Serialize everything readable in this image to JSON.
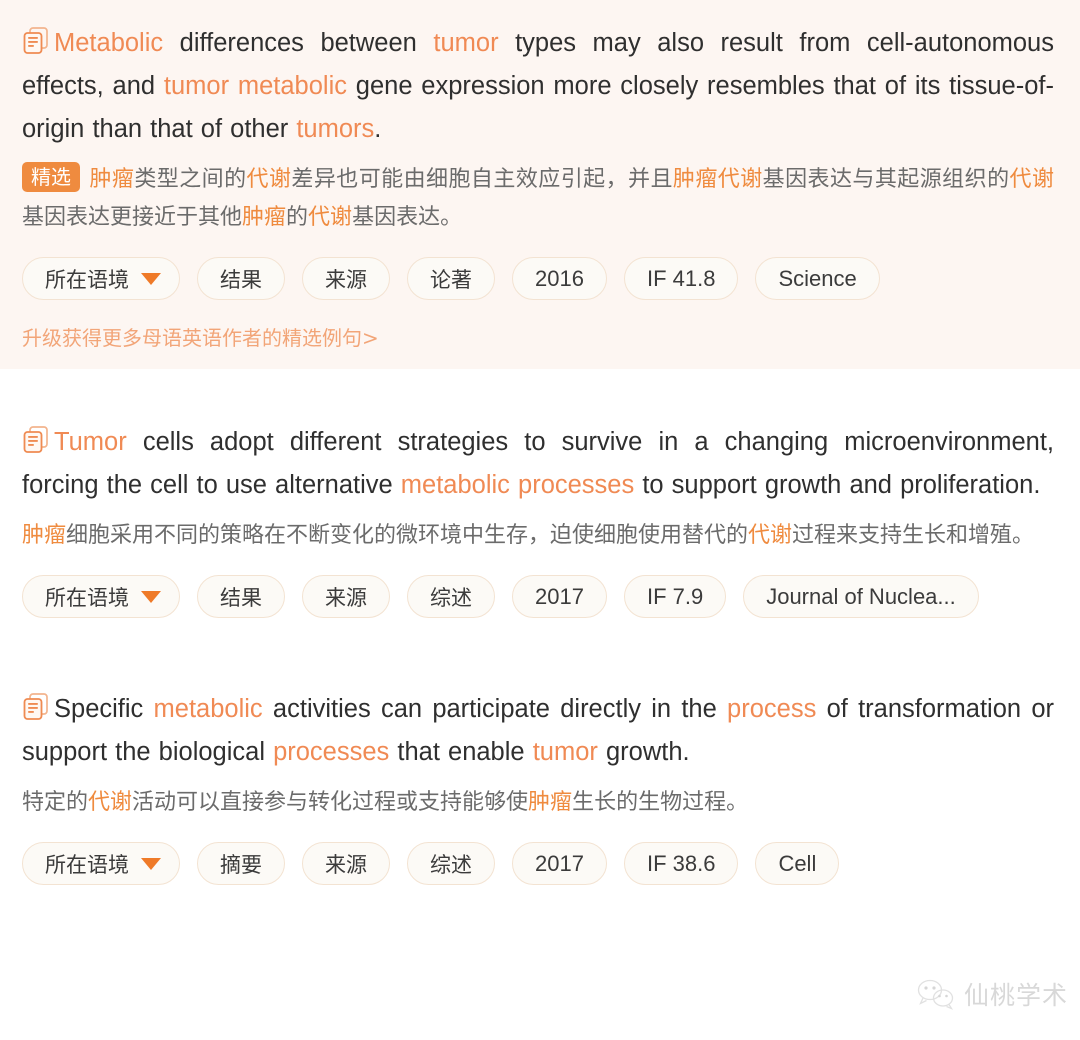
{
  "watermark": {
    "text": "仙桃学术",
    "icon": "wechat-icon"
  },
  "common": {
    "doc_icon": "document-stack-icon",
    "caret_icon": "chevron-down-icon"
  },
  "cards": [
    {
      "featured": true,
      "doc_icon": "document-stack-icon",
      "english": [
        {
          "t": "Metabolic",
          "hl": true
        },
        {
          "t": " differences between ",
          "hl": false
        },
        {
          "t": "tumor",
          "hl": true
        },
        {
          "t": " types may also result from cell-autonomous effects, and ",
          "hl": false
        },
        {
          "t": "tumor metabolic",
          "hl": true
        },
        {
          "t": " gene expression more closely resembles that of its tissue-of-origin than that of other ",
          "hl": false
        },
        {
          "t": "tumors",
          "hl": true
        },
        {
          "t": ".",
          "hl": false
        }
      ],
      "badge": "精选",
      "chinese": [
        {
          "t": "肿瘤",
          "hl": true
        },
        {
          "t": "类型之间的",
          "hl": false
        },
        {
          "t": "代谢",
          "hl": true
        },
        {
          "t": "差异也可能由细胞自主效应引起，并且",
          "hl": false
        },
        {
          "t": "肿瘤代谢",
          "hl": true
        },
        {
          "t": "基因表达与其起源组织的",
          "hl": false
        },
        {
          "t": "代谢",
          "hl": true
        },
        {
          "t": "基因表达更接近于其他",
          "hl": false
        },
        {
          "t": "肿瘤",
          "hl": true
        },
        {
          "t": "的",
          "hl": false
        },
        {
          "t": "代谢",
          "hl": true
        },
        {
          "t": "基因表达。",
          "hl": false
        }
      ],
      "tags": [
        {
          "label": "所在语境",
          "type": "context"
        },
        {
          "label": "结果",
          "type": "cn"
        },
        {
          "label": "来源",
          "type": "cn"
        },
        {
          "label": "论著",
          "type": "cn"
        },
        {
          "label": "2016",
          "type": "latin"
        },
        {
          "label": "IF 41.8",
          "type": "latin"
        },
        {
          "label": "Science",
          "type": "latin"
        }
      ],
      "upgrade_link": "升级获得更多母语英语作者的精选例句>"
    },
    {
      "featured": false,
      "doc_icon": "document-stack-icon",
      "english": [
        {
          "t": "Tumor",
          "hl": true
        },
        {
          "t": " cells adopt different strategies to survive in a changing microenvironment, forcing the cell to use alternative ",
          "hl": false
        },
        {
          "t": "metabolic processes",
          "hl": true
        },
        {
          "t": " to support growth and proliferation.",
          "hl": false
        }
      ],
      "badge": "",
      "chinese": [
        {
          "t": "肿瘤",
          "hl": true
        },
        {
          "t": "细胞采用不同的策略在不断变化的微环境中生存，迫使细胞使用替代的",
          "hl": false
        },
        {
          "t": "代谢",
          "hl": true
        },
        {
          "t": "过程来支持生长和增殖。",
          "hl": false
        }
      ],
      "tags": [
        {
          "label": "所在语境",
          "type": "context"
        },
        {
          "label": "结果",
          "type": "cn"
        },
        {
          "label": "来源",
          "type": "cn"
        },
        {
          "label": "综述",
          "type": "cn"
        },
        {
          "label": "2017",
          "type": "latin"
        },
        {
          "label": "IF 7.9",
          "type": "latin"
        },
        {
          "label": "Journal of Nuclea...",
          "type": "latin"
        }
      ],
      "upgrade_link": ""
    },
    {
      "featured": false,
      "doc_icon": "document-stack-icon",
      "english": [
        {
          "t": "Specific ",
          "hl": false
        },
        {
          "t": "metabolic",
          "hl": true
        },
        {
          "t": " activities can participate directly in the ",
          "hl": false
        },
        {
          "t": "process",
          "hl": true
        },
        {
          "t": " of transformation or support the biological ",
          "hl": false
        },
        {
          "t": "processes",
          "hl": true
        },
        {
          "t": " that enable ",
          "hl": false
        },
        {
          "t": "tumor",
          "hl": true
        },
        {
          "t": " growth.",
          "hl": false
        }
      ],
      "badge": "",
      "chinese": [
        {
          "t": "特定的",
          "hl": false
        },
        {
          "t": "代谢",
          "hl": true
        },
        {
          "t": "活动可以直接参与转化过程或支持能够使",
          "hl": false
        },
        {
          "t": "肿瘤",
          "hl": true
        },
        {
          "t": "生长的生物过程。",
          "hl": false
        }
      ],
      "tags": [
        {
          "label": "所在语境",
          "type": "context"
        },
        {
          "label": "摘要",
          "type": "cn"
        },
        {
          "label": "来源",
          "type": "cn"
        },
        {
          "label": "综述",
          "type": "cn"
        },
        {
          "label": "2017",
          "type": "latin"
        },
        {
          "label": "IF 38.6",
          "type": "latin"
        },
        {
          "label": "Cell",
          "type": "latin"
        }
      ],
      "upgrade_link": ""
    }
  ],
  "colors": {
    "accent": "#ef8b3f",
    "highlight_en": "#f08a54",
    "featured_bg": "#fdf6f2",
    "pill_border": "#f3e3d2",
    "pill_bg": "#fcfaf6",
    "text": "#2f2f2f",
    "text_secondary": "#6b6b6b",
    "link": "#f2a578"
  }
}
